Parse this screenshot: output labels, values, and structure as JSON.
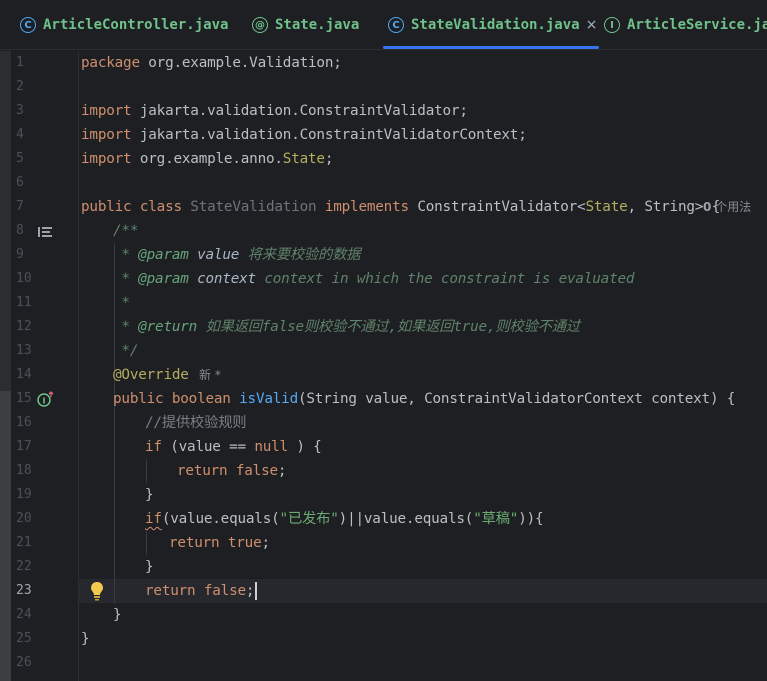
{
  "tabs": [
    {
      "label": "ArticleController.java",
      "icon": "class-icon",
      "icon_glyph": "C",
      "color": "#5fb3b3",
      "active": false
    },
    {
      "label": "State.java",
      "icon": "annotation-icon",
      "icon_glyph": "@",
      "color": "#5fb3b3",
      "active": false
    },
    {
      "label": "StateValidation.java",
      "icon": "class-icon",
      "icon_glyph": "C",
      "color": "#5fb3b3",
      "active": true,
      "close": "×"
    },
    {
      "label": "ArticleService.jav",
      "icon": "interface-icon",
      "icon_glyph": "I",
      "color": "#5fb3b3",
      "active": false
    }
  ],
  "editor": {
    "line_numbers": [
      "1",
      "2",
      "3",
      "4",
      "5",
      "6",
      "7",
      "8",
      "9",
      "10",
      "11",
      "12",
      "13",
      "14",
      "15",
      "16",
      "17",
      "18",
      "19",
      "20",
      "21",
      "22",
      "23",
      "24",
      "25",
      "26"
    ],
    "current_line": "23",
    "code": {
      "l1_kw": "package",
      "l1_rest": " org.example.Validation;",
      "l3_kw": "import",
      "l3_rest": " jakarta.validation.ConstraintValidator;",
      "l4_kw": "import",
      "l4_rest": " jakarta.validation.ConstraintValidatorContext;",
      "l5_kw": "import",
      "l5_rest": " org.example.anno.",
      "l5_an": "State",
      "l5_end": ";",
      "l7_kw": "public class",
      "l7_name": " StateValidation ",
      "l7_impl": "implements",
      "l7_rest": " ConstraintValidator<",
      "l7_an": "State",
      "l7_end": ", String> {",
      "l7_usage_count": "0",
      "l7_usage_text": "个用法",
      "l8": "/**",
      "l9_star": " * ",
      "l9_tag": "@param",
      "l9_param": " value",
      "l9_desc": " 将来要校验的数据",
      "l10_star": " * ",
      "l10_tag": "@param",
      "l10_param": " context",
      "l10_desc": " context in which the constraint is evaluated",
      "l11": " *",
      "l12_star": " * ",
      "l12_tag": "@return",
      "l12_desc": " 如果返回",
      "l12_false": "false",
      "l12_desc2": "则校验不通过,如果返回",
      "l12_true": "true",
      "l12_desc3": ",则校验不通过",
      "l13": " */",
      "l14_an": "@Override",
      "l14_hint": "新 *",
      "l15_kw": "public boolean",
      "l15_fn": " isValid",
      "l15_rest": "(String value, ConstraintValidatorContext context) {",
      "l16": "//提供校验规则",
      "l17_kw": "if",
      "l17_a": " (value == ",
      "l17_null": "null",
      "l17_b": " ) {",
      "l18_kw": "return false",
      "l18_end": ";",
      "l19": "}",
      "l20_kw": "if",
      "l20_a": "(value.equals(",
      "l20_s1": "\"已发布\"",
      "l20_b": ")||value.equals(",
      "l20_s2": "\"草稿\"",
      "l20_c": ")){",
      "l21_kw": "return true",
      "l21_end": ";",
      "l22": "}",
      "l23_kw": "return false",
      "l23_end": ";",
      "l24": "}",
      "l25": "}"
    }
  }
}
